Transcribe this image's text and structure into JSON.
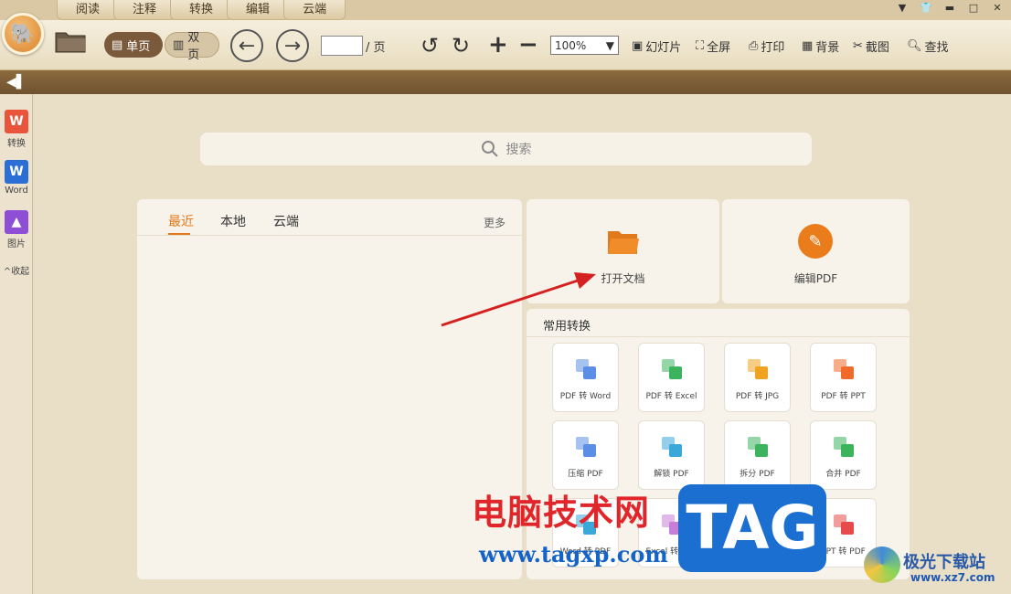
{
  "menu": {
    "tabs": [
      "阅读",
      "注释",
      "转换",
      "编辑",
      "云端"
    ]
  },
  "toolbar": {
    "single_page": "单页",
    "double_page": "双页",
    "page_value": "",
    "page_suffix": "/ 页",
    "zoom": "100%",
    "slideshow": "幻灯片",
    "fullscreen": "全屏",
    "print": "打印",
    "background": "背景",
    "screenshot": "截图",
    "find": "查找"
  },
  "sidebar": {
    "items": [
      {
        "label": "转换",
        "icon": "pdf-convert-icon",
        "color": "#e8553b"
      },
      {
        "label": "Word",
        "icon": "word-icon",
        "color": "#2b6fd6"
      },
      {
        "label": "图片",
        "icon": "image-icon",
        "color": "#8e4fd6"
      }
    ],
    "collapse_label": "收起"
  },
  "search": {
    "placeholder": "搜索"
  },
  "recent": {
    "tabs": [
      "最近",
      "本地",
      "云端"
    ],
    "more": "更多"
  },
  "actions": {
    "open_doc": "打开文档",
    "edit_pdf": "编辑PDF"
  },
  "conversions": {
    "title": "常用转换",
    "items": [
      {
        "label": "PDF 转 Word",
        "color": "#5b8fe6"
      },
      {
        "label": "PDF 转 Excel",
        "color": "#3cb45e"
      },
      {
        "label": "PDF 转 JPG",
        "color": "#f0a320"
      },
      {
        "label": "PDF 转 PPT",
        "color": "#f06a2a"
      },
      {
        "label": "压缩 PDF",
        "color": "#5b8fe6"
      },
      {
        "label": "解锁 PDF",
        "color": "#3aa8d8"
      },
      {
        "label": "拆分 PDF",
        "color": "#3cb45e"
      },
      {
        "label": "合并 PDF",
        "color": "#3cb45e"
      },
      {
        "label": "Word 转 PDF",
        "color": "#3aa8d8"
      },
      {
        "label": "Excel 转 PDF",
        "color": "#c77ed8"
      },
      {
        "label": "JPG 转 PDF",
        "color": "#5b8fe6"
      },
      {
        "label": "PPT 转 PDF",
        "color": "#e84a4a"
      }
    ]
  },
  "watermark": {
    "cn": "电脑技术网",
    "url": "www.tagxp.com",
    "tag": "TAG",
    "site": "极光下载站",
    "site_url": "www.xz7.com"
  },
  "colors": {
    "accent": "#e2791c",
    "arrow": "#d42020"
  }
}
